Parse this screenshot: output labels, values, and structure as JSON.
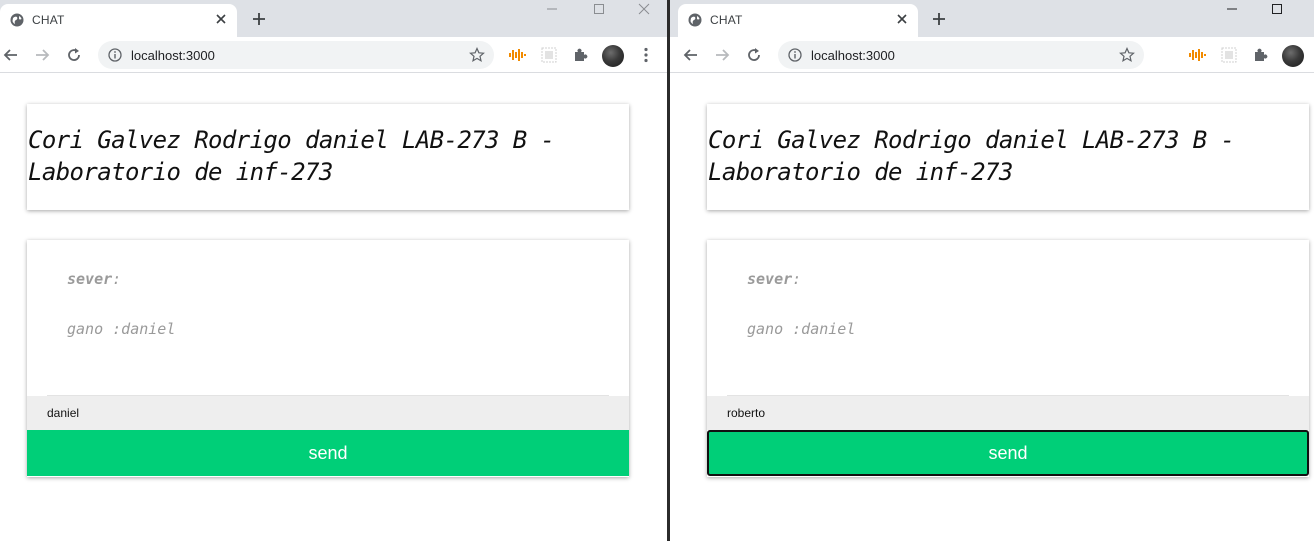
{
  "colors": {
    "accent": "#00cf78",
    "tabstrip": "#dee1e6",
    "omnibox": "#f1f3f4",
    "message_text": "#9a9a9a",
    "input_bg": "#eeeeee",
    "record_icon": "#f28b00"
  },
  "windows": [
    {
      "tab": {
        "title": "CHAT",
        "favicon": "globe-icon"
      },
      "address_bar": {
        "url": "localhost:3000"
      },
      "page": {
        "title_line1": "Cori Galvez Rodrigo daniel LAB-273 B -",
        "title_line2": "Laboratorio de inf-273",
        "messages": [
          {
            "author": "sever",
            "separator": ":",
            "text": ""
          },
          {
            "author": "",
            "separator": "",
            "text": "gano :daniel"
          }
        ],
        "handle_value": "daniel",
        "send_label": "send"
      }
    },
    {
      "tab": {
        "title": "CHAT",
        "favicon": "globe-icon"
      },
      "address_bar": {
        "url": "localhost:3000"
      },
      "page": {
        "title_line1": "Cori Galvez Rodrigo daniel LAB-273 B -",
        "title_line2": "Laboratorio de inf-273",
        "messages": [
          {
            "author": "sever",
            "separator": ":",
            "text": ""
          },
          {
            "author": "",
            "separator": "",
            "text": "gano :daniel"
          }
        ],
        "handle_value": "roberto",
        "send_label": "send"
      }
    }
  ]
}
